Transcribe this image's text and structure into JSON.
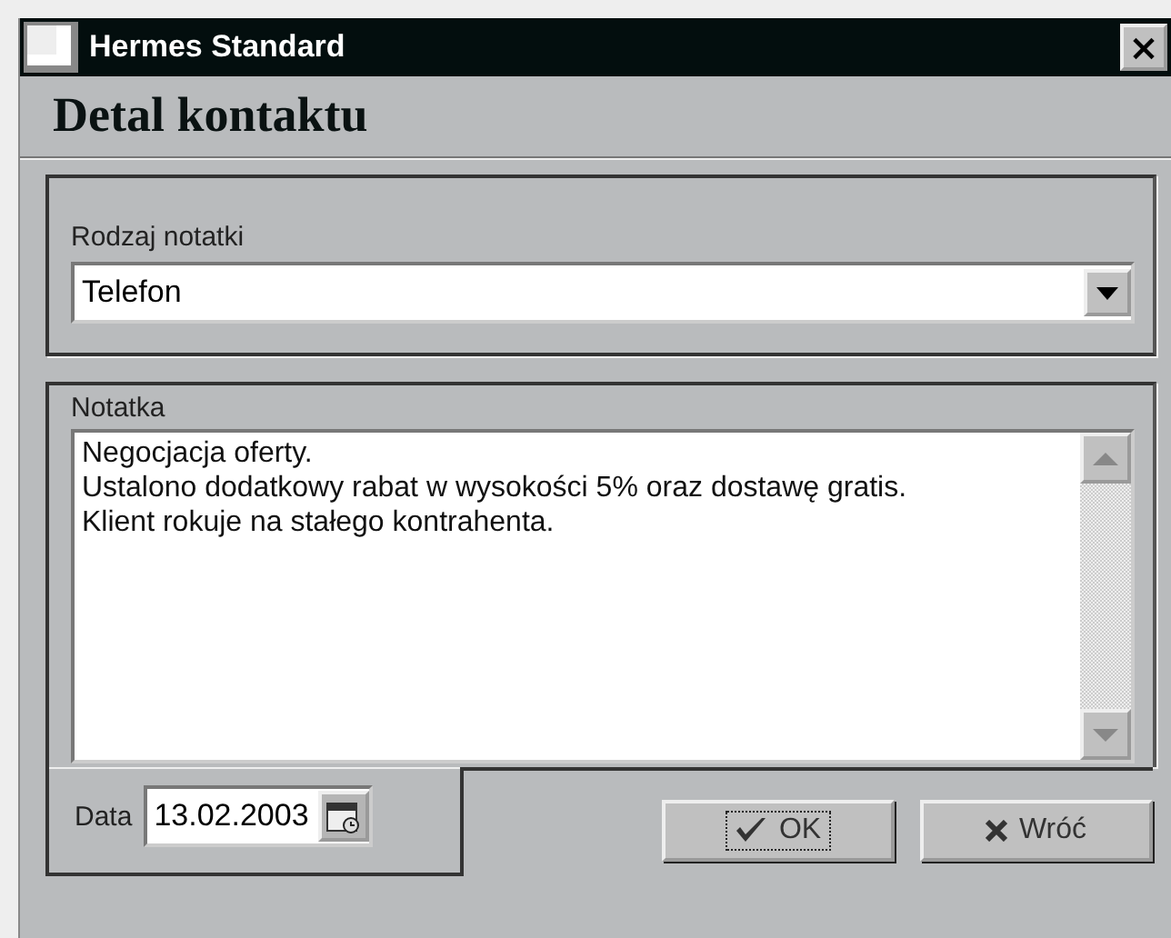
{
  "window": {
    "title": "Hermes Standard",
    "close": "×"
  },
  "heading": "Detal kontaktu",
  "note_type": {
    "label": "Rodzaj notatki",
    "value": "Telefon"
  },
  "note": {
    "label": "Notatka",
    "value": "Negocjacja oferty.\nUstalono dodatkowy rabat w wysokości 5% oraz dostawę gratis.\nKlient rokuje na stałego kontrahenta."
  },
  "date": {
    "label": "Data",
    "value": "13.02.2003"
  },
  "buttons": [
    {
      "kind": "ok",
      "label": "OK",
      "focused": true
    },
    {
      "kind": "back",
      "label": "Wróć",
      "focused": false
    }
  ]
}
